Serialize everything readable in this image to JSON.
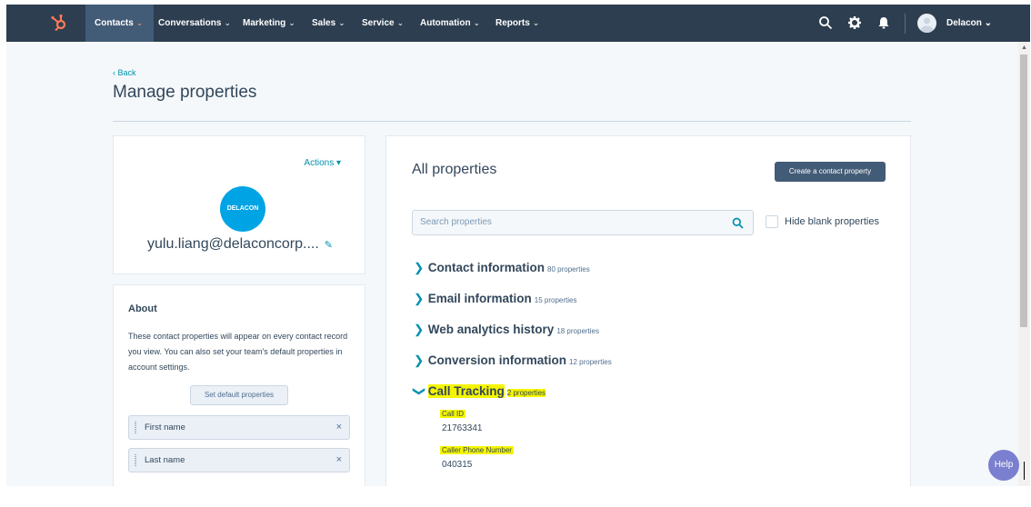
{
  "nav": {
    "items": [
      {
        "label": "Contacts",
        "active": true
      },
      {
        "label": "Conversations"
      },
      {
        "label": "Marketing"
      },
      {
        "label": "Sales"
      },
      {
        "label": "Service"
      },
      {
        "label": "Automation"
      },
      {
        "label": "Reports"
      }
    ],
    "chevron": "⌄",
    "user_name": "Delacon ⌄",
    "icons": [
      "hubspot-logo",
      "search-icon",
      "gear-icon",
      "bell-icon",
      "avatar"
    ]
  },
  "header": {
    "back_label": "‹  Back",
    "title": "Manage properties"
  },
  "profile": {
    "actions_label": "Actions ▾",
    "company_logo_text": "DELACON",
    "email": "yulu.liang@delaconcorp...."
  },
  "about": {
    "title": "About",
    "text": "These contact properties will appear on every contact record you view. You can also set your team's default properties in account settings.",
    "button_label": "Set default properties",
    "properties": [
      "First name",
      "Last name"
    ]
  },
  "main": {
    "title": "All properties",
    "create_button_label": "Create a contact property",
    "search_placeholder": "Search properties",
    "hide_blank_label": "Hide blank properties",
    "groups": [
      {
        "name": "Contact information",
        "count": "80 properties"
      },
      {
        "name": "Email information",
        "count": "15 properties"
      },
      {
        "name": "Web analytics history",
        "count": "18 properties"
      },
      {
        "name": "Conversion information",
        "count": "12 properties"
      },
      {
        "name": "Call Tracking",
        "count": "2 properties"
      }
    ],
    "call_tracking_properties": [
      {
        "label": "Call ID",
        "value": "21763341"
      },
      {
        "label": "Caller Phone Number",
        "value": "040315"
      }
    ]
  },
  "help_label": "Help",
  "colors": {
    "nav_bg": "#2d3e50",
    "accent": "#0091ae",
    "primary_button": "#425b76",
    "highlight": "#f5f500",
    "hubspot_orange": "#ff7a59",
    "help_bubble": "#7b7fcf"
  }
}
